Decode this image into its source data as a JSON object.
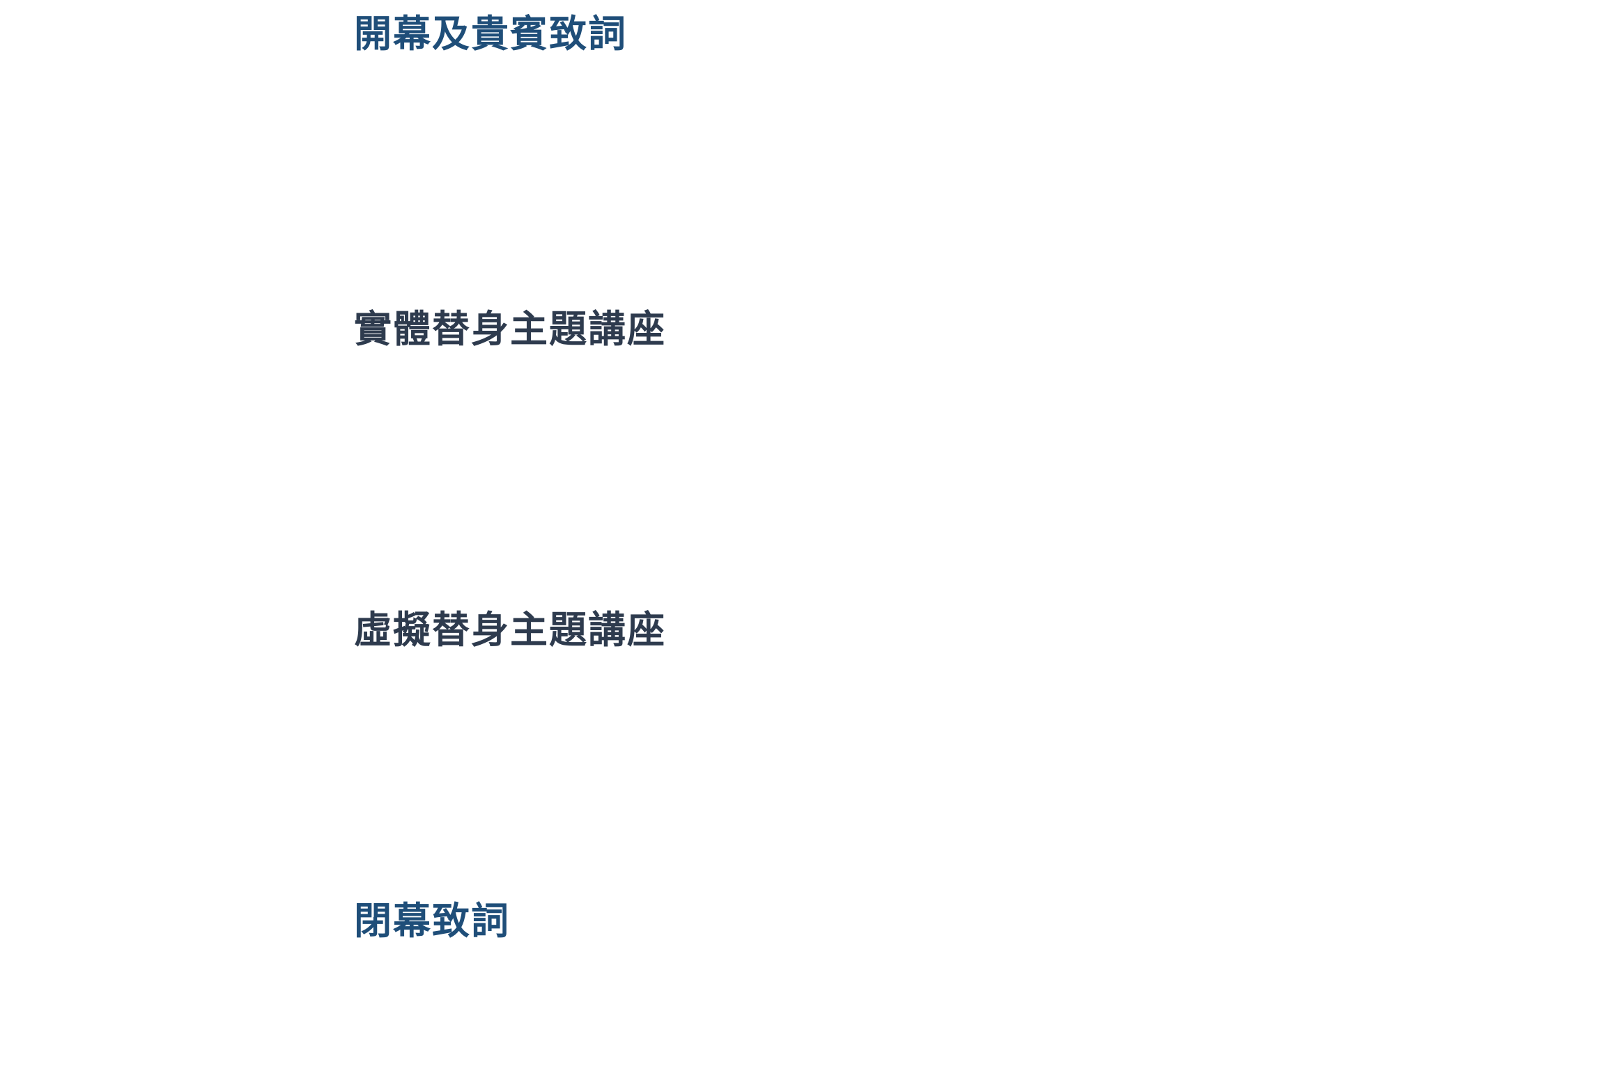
{
  "sections": [
    {
      "title": "開幕及貴賓致詞",
      "color": "#1f4e79"
    },
    {
      "title": "實體替身主題講座",
      "color": "#2e3b4e"
    },
    {
      "title": "虛擬替身主題講座",
      "color": "#2e3b4e"
    },
    {
      "title": "閉幕致詞",
      "color": "#1f4e79"
    }
  ]
}
